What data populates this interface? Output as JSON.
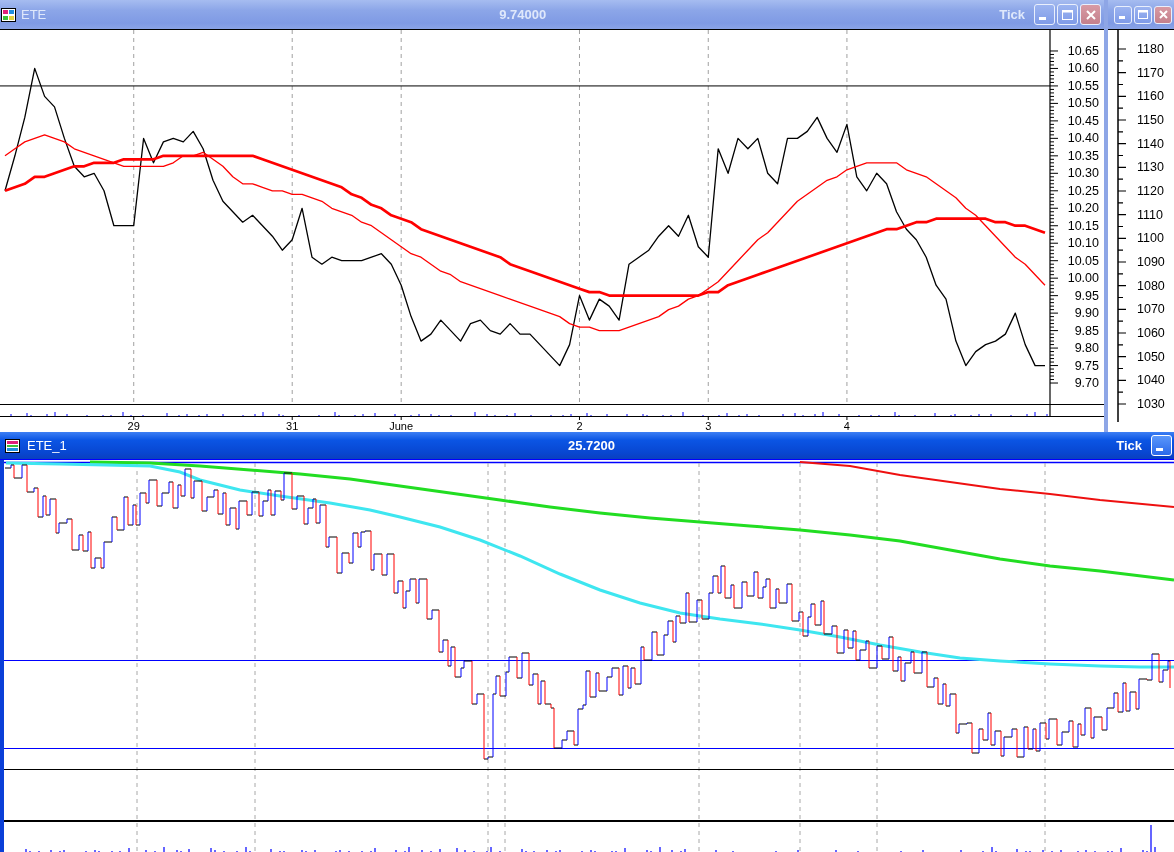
{
  "chart_window": {
    "title": "ETE",
    "last_price": "9.74000",
    "interval": "Tick",
    "active": false,
    "chart_data": {
      "type": "line",
      "grid": "x",
      "categories": [
        null,
        null,
        null,
        null,
        null,
        null,
        null,
        null,
        null,
        null,
        null,
        null,
        null,
        "29",
        null,
        null,
        null,
        null,
        null,
        null,
        null,
        null,
        null,
        null,
        null,
        null,
        null,
        null,
        null,
        "31",
        null,
        null,
        null,
        null,
        null,
        null,
        null,
        null,
        null,
        null,
        "June",
        null,
        null,
        null,
        null,
        null,
        null,
        null,
        null,
        null,
        null,
        null,
        null,
        null,
        null,
        null,
        null,
        null,
        "2",
        null,
        null,
        null,
        null,
        null,
        null,
        null,
        null,
        null,
        null,
        null,
        null,
        "3",
        null,
        null,
        null,
        null,
        null,
        null,
        null,
        null,
        null,
        null,
        null,
        null,
        null,
        "4",
        null,
        null,
        null,
        null,
        null,
        null,
        null,
        null,
        null,
        null,
        null,
        null,
        null,
        null,
        null,
        null,
        null,
        null,
        null,
        null
      ],
      "ylim": [
        9.64,
        10.71
      ],
      "yticks": [
        {
          "value": 9.7,
          "label": "9.70"
        },
        {
          "value": 9.75,
          "label": "9.75"
        },
        {
          "value": 9.8,
          "label": "9.80"
        },
        {
          "value": 9.85,
          "label": "9.85"
        },
        {
          "value": 9.9,
          "label": "9.90"
        },
        {
          "value": 9.95,
          "label": "9.95"
        },
        {
          "value": 10.0,
          "label": "10.00"
        },
        {
          "value": 10.05,
          "label": "10.05"
        },
        {
          "value": 10.1,
          "label": "10.10"
        },
        {
          "value": 10.15,
          "label": "10.15"
        },
        {
          "value": 10.2,
          "label": "10.20"
        },
        {
          "value": 10.25,
          "label": "10.25"
        },
        {
          "value": 10.3,
          "label": "10.30"
        },
        {
          "value": 10.35,
          "label": "10.35"
        },
        {
          "value": 10.4,
          "label": "10.40"
        },
        {
          "value": 10.45,
          "label": "10.45"
        },
        {
          "value": 10.5,
          "label": "10.50"
        },
        {
          "value": 10.55,
          "label": "10.55"
        },
        {
          "value": 10.6,
          "label": "10.60"
        },
        {
          "value": 10.65,
          "label": "10.65"
        }
      ],
      "series": [
        {
          "color": "#000000",
          "values": [
            10.25,
            10.35,
            10.46,
            10.6,
            10.52,
            10.49,
            10.4,
            10.32,
            10.29,
            10.3,
            10.25,
            10.15,
            10.15,
            10.15,
            10.4,
            10.33,
            10.39,
            10.4,
            10.39,
            10.42,
            10.37,
            10.28,
            10.22,
            10.19,
            10.16,
            10.18,
            10.15,
            10.12,
            10.08,
            10.11,
            10.2,
            10.06,
            10.04,
            10.06,
            10.05,
            10.05,
            10.05,
            10.06,
            10.07,
            10.04,
            9.98,
            9.89,
            9.82,
            9.84,
            9.88,
            9.85,
            9.82,
            9.87,
            9.88,
            9.85,
            9.84,
            9.87,
            9.84,
            9.84,
            9.81,
            9.78,
            9.75,
            9.81,
            9.95,
            9.88,
            9.94,
            9.92,
            9.88,
            10.04,
            10.06,
            10.08,
            10.12,
            10.15,
            10.12,
            10.18,
            10.09,
            10.06,
            10.37,
            10.3,
            10.4,
            10.37,
            10.4,
            10.3,
            10.27,
            10.4,
            10.4,
            10.42,
            10.46,
            10.4,
            10.36,
            10.44,
            10.29,
            10.25,
            10.3,
            10.27,
            10.19,
            10.14,
            10.11,
            10.06,
            9.98,
            9.94,
            9.82,
            9.75,
            9.79,
            9.81,
            9.82,
            9.84,
            9.9,
            9.81,
            9.75,
            9.75
          ]
        },
        {
          "color": "#ff0000",
          "values": [
            10.35,
            10.37,
            10.39,
            10.4,
            10.41,
            10.4,
            10.39,
            10.37,
            10.36,
            10.35,
            10.34,
            10.33,
            10.32,
            10.32,
            10.32,
            10.32,
            10.32,
            10.33,
            10.35,
            10.35,
            10.36,
            10.34,
            10.32,
            10.29,
            10.27,
            10.27,
            10.26,
            10.25,
            10.25,
            10.24,
            10.24,
            10.23,
            10.22,
            10.2,
            10.19,
            10.18,
            10.16,
            10.15,
            10.13,
            10.11,
            10.09,
            10.07,
            10.06,
            10.04,
            10.02,
            10.01,
            9.99,
            9.98,
            9.97,
            9.96,
            9.95,
            9.94,
            9.93,
            9.92,
            9.91,
            9.9,
            9.89,
            9.87,
            9.86,
            9.86,
            9.85,
            9.85,
            9.85,
            9.86,
            9.87,
            9.88,
            9.89,
            9.91,
            9.92,
            9.94,
            9.95,
            9.97,
            9.99,
            10.02,
            10.05,
            10.08,
            10.11,
            10.13,
            10.16,
            10.19,
            10.22,
            10.24,
            10.26,
            10.28,
            10.29,
            10.31,
            10.32,
            10.33,
            10.33,
            10.33,
            10.33,
            10.31,
            10.3,
            10.29,
            10.27,
            10.25,
            10.23,
            10.2,
            10.18,
            10.15,
            10.12,
            10.09,
            10.06,
            10.04,
            10.01,
            9.98
          ]
        },
        {
          "color": "#ff0000",
          "values": [
            10.25,
            10.26,
            10.27,
            10.29,
            10.29,
            10.3,
            10.31,
            10.32,
            10.32,
            10.33,
            10.33,
            10.33,
            10.34,
            10.34,
            10.34,
            10.34,
            10.35,
            10.35,
            10.35,
            10.35,
            10.35,
            10.35,
            10.35,
            10.35,
            10.35,
            10.35,
            10.34,
            10.33,
            10.32,
            10.31,
            10.3,
            10.29,
            10.28,
            10.27,
            10.26,
            10.24,
            10.23,
            10.21,
            10.2,
            10.18,
            10.17,
            10.16,
            10.14,
            10.13,
            10.12,
            10.11,
            10.1,
            10.09,
            10.08,
            10.07,
            10.06,
            10.04,
            10.03,
            10.02,
            10.01,
            10.0,
            9.99,
            9.98,
            9.97,
            9.96,
            9.96,
            9.95,
            9.95,
            9.95,
            9.95,
            9.95,
            9.95,
            9.95,
            9.95,
            9.95,
            9.95,
            9.96,
            9.96,
            9.98,
            9.99,
            10.0,
            10.01,
            10.02,
            10.03,
            10.04,
            10.05,
            10.06,
            10.07,
            10.08,
            10.09,
            10.1,
            10.11,
            10.12,
            10.13,
            10.14,
            10.14,
            10.15,
            10.16,
            10.16,
            10.17,
            10.17,
            10.17,
            10.17,
            10.17,
            10.17,
            10.16,
            10.16,
            10.15,
            10.15,
            10.14,
            10.13
          ]
        }
      ],
      "ref_lines": [
        {
          "axis": "y",
          "value": 10.55
        }
      ]
    }
  },
  "background_window": {
    "active": false,
    "axis_labels": [
      "1180",
      "1170",
      "1160",
      "1150",
      "1140",
      "1130",
      "1120",
      "1110",
      "1100",
      "1090",
      "1080",
      "1070",
      "1060",
      "1050",
      "1040",
      "1030"
    ]
  },
  "indicator_window": {
    "title": "ETE_1",
    "last_value": "25.7200",
    "interval": "Tick",
    "active": true
  }
}
